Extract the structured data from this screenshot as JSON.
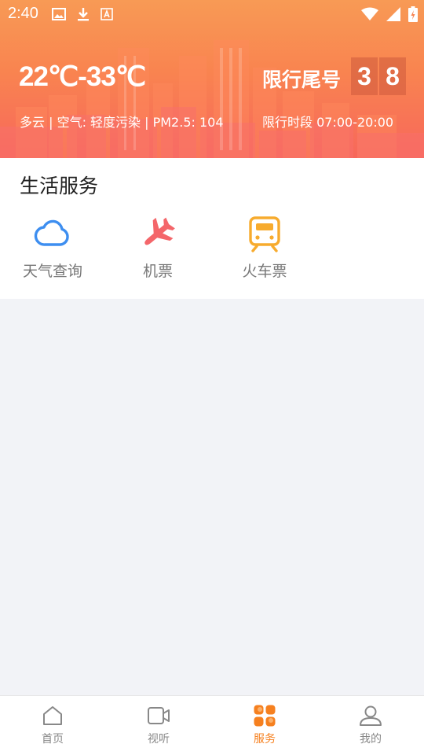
{
  "status_bar": {
    "time": "2:40"
  },
  "header": {
    "temperature": "22℃-33℃",
    "weather": "多云 | 空气: 轻度污染 | PM2.5: 104",
    "restriction_label": "限行尾号",
    "restriction_digits": [
      "3",
      "8"
    ],
    "restriction_time": "限行时段 07:00-20:00"
  },
  "services": {
    "title": "生活服务",
    "items": [
      {
        "label": "天气查询",
        "icon": "cloud-icon",
        "color": "#3d8ef0"
      },
      {
        "label": "机票",
        "icon": "airplane-icon",
        "color": "#f4666a"
      },
      {
        "label": "火车票",
        "icon": "train-icon",
        "color": "#f7ab2e"
      }
    ]
  },
  "tabbar": {
    "active_color": "#f6801f",
    "items": [
      {
        "label": "首页",
        "icon": "home-icon"
      },
      {
        "label": "视听",
        "icon": "video-icon"
      },
      {
        "label": "服务",
        "icon": "services-grid-icon",
        "active": true
      },
      {
        "label": "我的",
        "icon": "profile-icon"
      }
    ]
  }
}
